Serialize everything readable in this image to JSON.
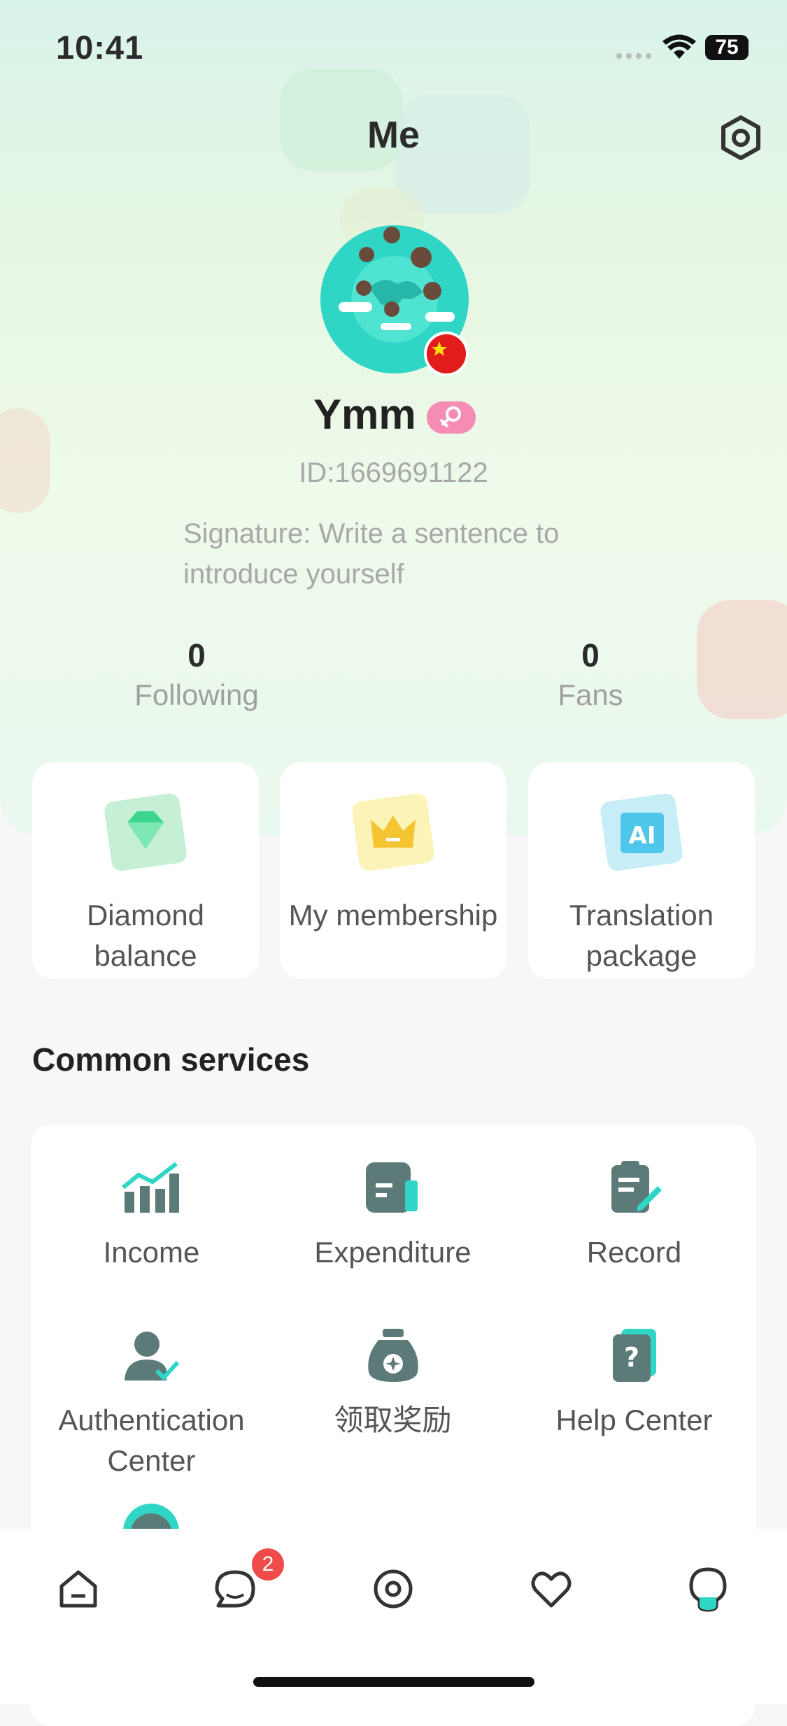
{
  "status_bar": {
    "time": "10:41",
    "battery": "75"
  },
  "header": {
    "title": "Me",
    "settings_icon": "gear-icon"
  },
  "profile": {
    "username": "Ymm",
    "gender_icon": "female-icon",
    "id_text": "ID:1669691122",
    "signature": "Signature: Write a sentence to introduce yourself"
  },
  "stats": [
    {
      "value": "0",
      "label": "Following"
    },
    {
      "value": "0",
      "label": "Fans"
    }
  ],
  "quick_cards": [
    {
      "label": "Diamond balance",
      "icon": "diamond-icon"
    },
    {
      "label": "My membership",
      "icon": "crown-icon"
    },
    {
      "label": "Translation package",
      "icon": "ai-translate-icon"
    }
  ],
  "services": {
    "title": "Common services",
    "items": [
      {
        "label": "Income",
        "icon": "chart-up-icon"
      },
      {
        "label": "Expenditure",
        "icon": "wallet-icon"
      },
      {
        "label": "Record",
        "icon": "clipboard-icon"
      },
      {
        "label": "Authentication Center",
        "icon": "user-verified-icon"
      },
      {
        "label": "领取奖励",
        "icon": "reward-bag-icon"
      },
      {
        "label": "Help Center",
        "icon": "help-book-icon"
      }
    ]
  },
  "tabbar": {
    "items": [
      {
        "icon": "home-icon"
      },
      {
        "icon": "chat-icon",
        "badge": "2"
      },
      {
        "icon": "discover-icon"
      },
      {
        "icon": "heart-icon"
      },
      {
        "icon": "profile-icon"
      }
    ]
  },
  "colors": {
    "accent": "#2fd6c6",
    "badge": "#ef4b4b",
    "gender_pink": "#f58cb3"
  }
}
